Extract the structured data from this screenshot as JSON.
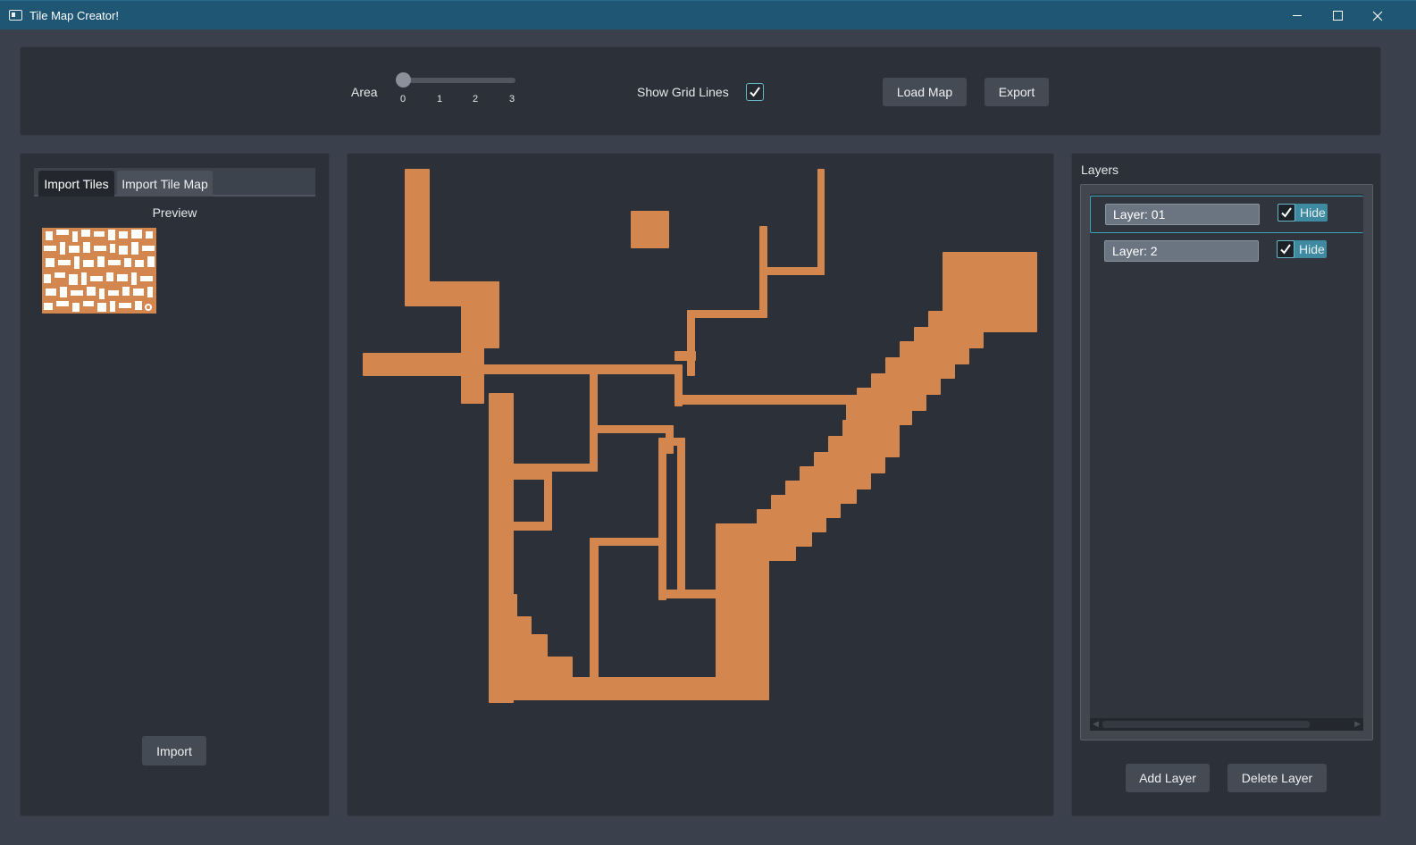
{
  "window": {
    "title": "Tile Map Creator!"
  },
  "toolbar": {
    "area_label": "Area",
    "area_value": 0,
    "area_ticks": [
      "0",
      "1",
      "2",
      "3"
    ],
    "grid_label": "Show Grid Lines",
    "grid_checked": true,
    "load_label": "Load Map",
    "export_label": "Export"
  },
  "left": {
    "tabs": [
      {
        "label": "Import Tiles",
        "active": true
      },
      {
        "label": "Import Tile Map",
        "active": false
      }
    ],
    "preview_label": "Preview",
    "import_label": "Import"
  },
  "right": {
    "title": "Layers",
    "layers": [
      {
        "name": "Layer: 01",
        "hide_label": "Hide",
        "hidden": true,
        "selected": true
      },
      {
        "name": "Layer: 2",
        "hide_label": "Hide",
        "hidden": true,
        "selected": false
      }
    ],
    "add_label": "Add Layer",
    "delete_label": "Delete Layer"
  },
  "colors": {
    "titlebar": "#1f5674",
    "tile": "#d3874f",
    "panel": "#2c3038",
    "background": "#3a414c",
    "accent": "#6ab6c6"
  }
}
